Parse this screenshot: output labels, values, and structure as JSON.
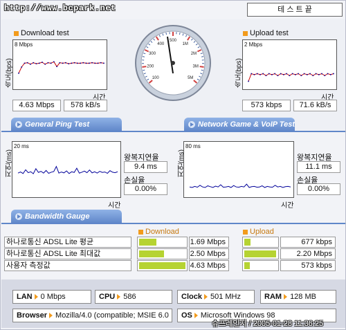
{
  "header": {
    "url": "http://www.bcpark.net",
    "test_end_label": "테 스 트  끝"
  },
  "download": {
    "title": "Download test",
    "ylabel": "속도(bps)",
    "scale": "8 Mbps",
    "xlabel": "시간",
    "bps": "4.63 Mbps",
    "bytes": "578 kB/s",
    "chart_data": {
      "type": "line",
      "ylim": [
        0,
        8
      ],
      "y": [
        2.5,
        3.8,
        4.6,
        4.7,
        4.4,
        4.7,
        4.5,
        4.6,
        4.8,
        4.4,
        4.7,
        4.6,
        4.9,
        3.9,
        4.7,
        4.6,
        4.7,
        4.5,
        4.6,
        4.7,
        4.6,
        4.6,
        4.7,
        4.6,
        4.6,
        4.7,
        4.6,
        4.6,
        4.7,
        4.6
      ]
    }
  },
  "upload": {
    "title": "Upload test",
    "ylabel": "속도(bps)",
    "scale": "2 Mbps",
    "xlabel": "시간",
    "bps": "573 kbps",
    "bytes": "71.6 kB/s",
    "chart_data": {
      "type": "line",
      "ylim": [
        0,
        2
      ],
      "y": [
        0.2,
        0.6,
        0.55,
        0.6,
        0.55,
        0.6,
        0.5,
        0.6,
        0.55,
        0.6,
        0.5,
        0.6,
        0.55,
        0.6,
        0.5,
        0.6,
        0.55,
        0.6,
        0.5,
        0.6,
        0.55,
        0.6,
        0.5,
        0.6,
        0.55,
        0.6,
        0.5,
        0.6,
        0.55,
        0.6
      ]
    }
  },
  "gauge": {
    "ticks": [
      "100",
      "200",
      "300",
      "400",
      "500",
      "1M",
      "2M",
      "3M",
      "5M"
    ]
  },
  "ping": {
    "tab_label": "General Ping Test",
    "ylabel": "지연(ms)",
    "scale": "20 ms",
    "xlabel": "시간",
    "rtt_label": "왕복지연율",
    "rtt": "9.4 ms",
    "loss_label": "손실율",
    "loss": "0.00%",
    "chart_data": {
      "type": "line",
      "ylim": [
        0,
        20
      ],
      "y": [
        9,
        9.5,
        8.8,
        10.5,
        9.2,
        9.6,
        8.7,
        11,
        9.3,
        9.8,
        9,
        10.2,
        8.9,
        9.4,
        9.7,
        12,
        9,
        9.5,
        9.1,
        10,
        8.8,
        9.6,
        9.3,
        11.2,
        9,
        9.4,
        9.9,
        9.2,
        10.4,
        9.1,
        9.6,
        9,
        9.8,
        9.3,
        9.5,
        8.9,
        10.1,
        9.4,
        9.2,
        9.6
      ]
    }
  },
  "game": {
    "tab_label": "Network Game & VoIP Test",
    "ylabel": "지연(ms)",
    "scale": "80 ms",
    "xlabel": "시간",
    "rtt_label": "왕복지연율",
    "rtt": "11.1 ms",
    "loss_label": "손실율",
    "loss": "0.00%",
    "chart_data": {
      "type": "line",
      "ylim": [
        0,
        80
      ],
      "y": [
        11,
        10,
        12,
        10.5,
        14,
        11,
        10,
        13,
        11.5,
        10,
        12.5,
        11,
        15,
        10.5,
        11,
        12,
        10,
        13.5,
        11,
        10.5,
        12,
        11,
        16,
        10,
        11.5,
        12,
        10.5,
        11,
        13,
        10,
        12,
        11,
        10.5,
        14,
        11,
        12,
        10,
        11.5,
        12,
        11
      ]
    }
  },
  "bandwidth": {
    "tab_label": "Bandwidth Gauge",
    "download_header": "Download",
    "upload_header": "Upload",
    "rows": [
      {
        "label": "하나로통신 ADSL Lite 평균",
        "down": "1.69 Mbps",
        "down_frac": 0.37,
        "up": "677 kbps",
        "up_frac": 0.2
      },
      {
        "label": "하나로통신 ADSL Lite 최대값",
        "down": "2.50 Mbps",
        "down_frac": 0.54,
        "up": "2.20 Mbps",
        "up_frac": 0.98
      },
      {
        "label": "사용자 측정값",
        "down": "4.63 Mbps",
        "down_frac": 1.0,
        "up": "573 kbps",
        "up_frac": 0.17
      }
    ]
  },
  "system": {
    "lan_key": "LAN",
    "lan": "0 Mbps",
    "cpu_key": "CPU",
    "cpu": "586",
    "clock_key": "Clock",
    "clock": "501 MHz",
    "ram_key": "RAM",
    "ram": "128 MB",
    "browser_key": "Browser",
    "browser": "Mozilla/4.0 (compatible; MSIE 6.0",
    "os_key": "OS",
    "os": "Microsoft Windows 98"
  },
  "footer": {
    "timestamp": "슈프레인지 / 2005-01-28 11:36:25"
  },
  "colors": {
    "accent": "#f29b1c",
    "tab": "#5f86c9",
    "bar": "#b6d332",
    "line_red": "#cc0000",
    "line_blue": "#000099"
  }
}
